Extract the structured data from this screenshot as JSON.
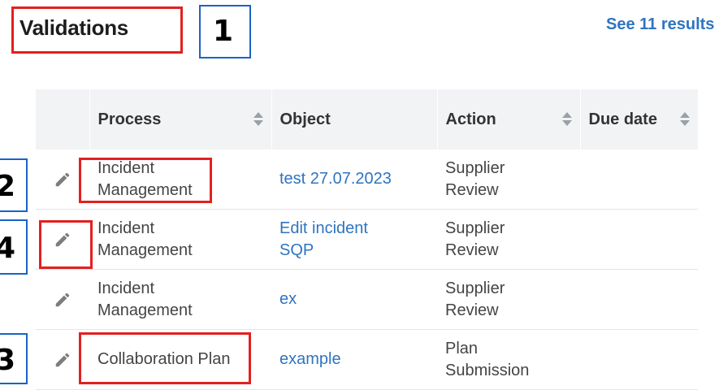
{
  "header": {
    "title": "Validations",
    "see_results": "See 11 results"
  },
  "annotations": [
    "1",
    "2",
    "4",
    "3"
  ],
  "table": {
    "columns": [
      "Process",
      "Object",
      "Action",
      "Due date"
    ],
    "rows": [
      {
        "process": "Incident\nManagement",
        "object": "test 27.07.2023",
        "action": "Supplier\nReview",
        "due_date": ""
      },
      {
        "process": "Incident\nManagement",
        "object": "Edit incident\nSQP",
        "action": "Supplier\nReview",
        "due_date": ""
      },
      {
        "process": "Incident\nManagement",
        "object": "ex",
        "action": "Supplier\nReview",
        "due_date": ""
      },
      {
        "process": "Collaboration Plan",
        "object": "example",
        "action": "Plan\nSubmission",
        "due_date": ""
      }
    ]
  },
  "icons": {
    "edit": "pencil-icon",
    "sort": "sort-icon"
  },
  "colors": {
    "link": "#2f74c0",
    "header_bg": "#f2f3f5",
    "annotation_red": "#e32020",
    "annotation_blue": "#1a63c6"
  }
}
